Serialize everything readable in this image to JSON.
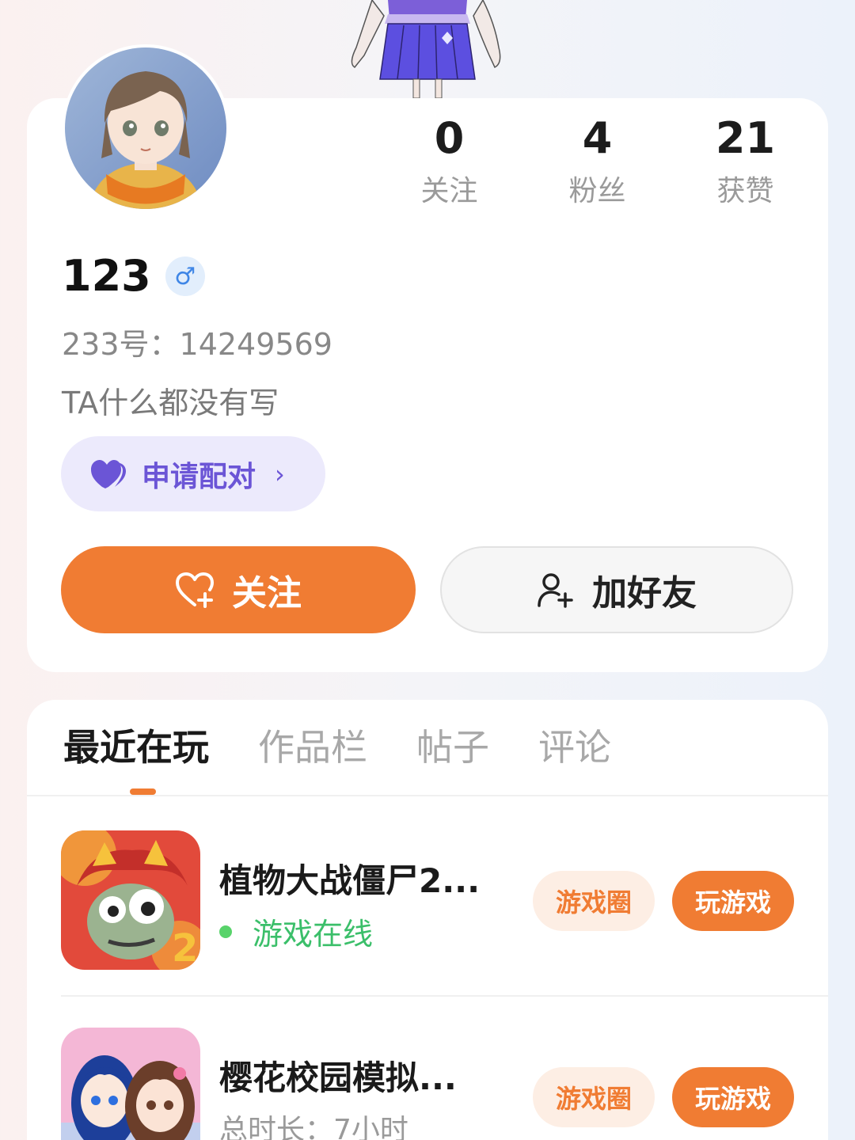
{
  "profile": {
    "username": "123",
    "gender_symbol": "♂",
    "uid_text": "233号：14249569",
    "bio": "TA什么都没有写",
    "stats": [
      {
        "value": "0",
        "label": "关注"
      },
      {
        "value": "4",
        "label": "粉丝"
      },
      {
        "value": "21",
        "label": "获赞"
      }
    ],
    "pair_button": {
      "label": "申请配对",
      "chevron": "›"
    },
    "follow_button": {
      "label": "关注"
    },
    "add_friend_button": {
      "label": "加好友"
    }
  },
  "tabs": [
    {
      "label": "最近在玩",
      "active": true
    },
    {
      "label": "作品栏",
      "active": false
    },
    {
      "label": "帖子",
      "active": false
    },
    {
      "label": "评论",
      "active": false
    }
  ],
  "games": [
    {
      "title": "植物大战僵尸2...",
      "status": "游戏在线",
      "circle_label": "游戏圈",
      "play_label": "玩游戏"
    },
    {
      "title": "樱花校园模拟...",
      "meta": "总时长：7小时",
      "circle_label": "游戏圈",
      "play_label": "玩游戏"
    }
  ],
  "colors": {
    "accent": "#f07c33",
    "pair_purple": "#6b55d6",
    "online_green": "#3bbf6a",
    "gender_blue": "#3f86e6"
  },
  "icons": [
    "heart-pair-icon",
    "heart-plus-icon",
    "user-plus-icon",
    "chevron-right-icon",
    "male-icon"
  ]
}
